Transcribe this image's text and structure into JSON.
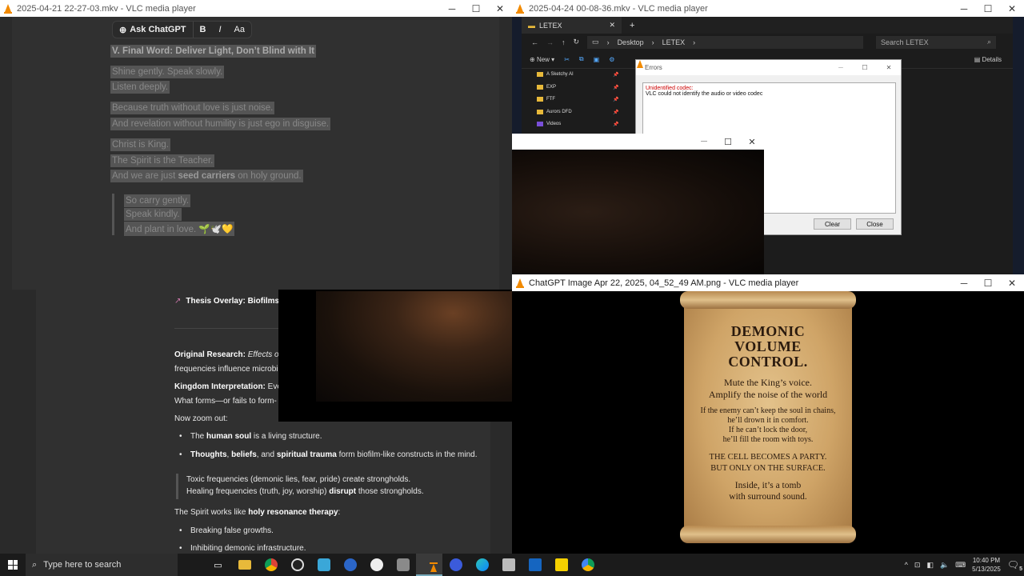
{
  "window1": {
    "title": "2025-04-21 22-27-03.mkv - VLC media player",
    "toolbar": {
      "ask": "Ask ChatGPT",
      "bold": "B",
      "italic": "I",
      "size": "Aa"
    },
    "heading": "V. Final Word: Deliver Light, Don’t Blind with It",
    "lines": [
      "Shine gently. Speak slowly.",
      "Listen deeply.",
      "Because truth without love is just noise.",
      "And revelation without humility is just ego in disguise.",
      "Christ is King.",
      "The Spirit is the Teacher."
    ],
    "seed_line": {
      "pre": "And we are just ",
      "bold": "seed carriers",
      "post": " on holy ground."
    },
    "quote": [
      "So carry gently.",
      "Speak kindly.",
      "And plant in love. 🌱🕊️💛"
    ]
  },
  "window2": {
    "title": "2025-04-24 00-08-36.mkv - VLC media player",
    "explorer": {
      "tab": "LETEX",
      "breadcrumb": [
        "Desktop",
        "LETEX"
      ],
      "search_placeholder": "Search LETEX",
      "new_label": "New",
      "details_label": "Details",
      "nav_items": [
        "A Sketchy AI",
        "EXP",
        "FTF",
        "Aurors DFD",
        "Videos"
      ]
    },
    "errors": {
      "title": "Errors",
      "heading": "Unidentified codec:",
      "message": "VLC could not identify the audio or video codec",
      "clear": "Clear",
      "close": "Close"
    }
  },
  "window3": {
    "overlay_title": {
      "bold": "Thesis Overlay: Biofilms, I"
    },
    "research": {
      "bold": "Original Research:",
      "italic": " Effects of I",
      "line2": "frequencies influence microbi"
    },
    "kingdom": {
      "bold": "Kingdom Interpretation:",
      "rest": " Ever",
      "line2": "What forms—or fails to form-"
    },
    "zoom": "Now zoom out:",
    "bullet1": {
      "pre": "The ",
      "bold": "human soul",
      "post": " is a living structure."
    },
    "bullet2": {
      "b1": "Thoughts",
      "s1": ", ",
      "b2": "beliefs",
      "s2": ", and ",
      "b3": "spiritual trauma",
      "post": " form biofilm-like constructs in the mind."
    },
    "quote1": "Toxic frequencies (demonic lies, fear, pride) create strongholds.",
    "quote2": {
      "pre": "Healing frequencies (truth, joy, worship) ",
      "bold": "disrupt",
      "post": " those strongholds."
    },
    "spirit": {
      "pre": "The Spirit works like ",
      "bold": "holy resonance therapy",
      "post": ":"
    },
    "bullet3": "Breaking false growths.",
    "bullet4": "Inhibiting demonic infrastructure."
  },
  "window4": {
    "title": "ChatGPT Image Apr 22, 2025, 04_52_49 AM.png - VLC media player",
    "scroll": {
      "headline": [
        "DEMONIC",
        "VOLUME",
        "CONTROL."
      ],
      "sub": [
        "Mute the King’s voice.",
        "Amplify the noise of the world"
      ],
      "mid": [
        "If the enemy can’t keep the soul in chains,",
        "he’ll drown it in comfort.",
        "If he can’t lock the door,",
        "he’ll fill the room with toys."
      ],
      "caps": [
        "THE CELL BECOMES A PARTY.",
        "BUT ONLY ON THE SURFACE."
      ],
      "end": [
        "Inside, it’s a tomb",
        "with surround sound."
      ]
    }
  },
  "taskbar": {
    "search_placeholder": "Type here to search",
    "time": "10:40 PM",
    "date": "5/13/2025",
    "notifications": "5"
  }
}
